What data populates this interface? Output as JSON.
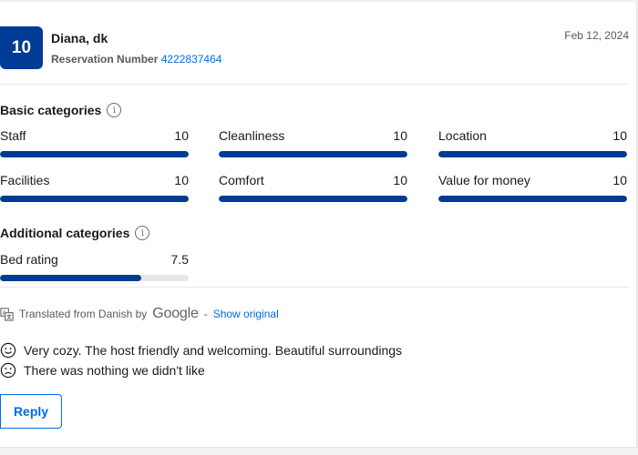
{
  "review": {
    "score": "10",
    "guest_name": "Diana, dk",
    "reservation_label": "Reservation Number",
    "reservation_number": "4222837464",
    "date": "Feb 12, 2024"
  },
  "basic": {
    "title": "Basic categories",
    "info_glyph": "i",
    "items": [
      {
        "label": "Staff",
        "value": "10",
        "fraction": 1.0
      },
      {
        "label": "Cleanliness",
        "value": "10",
        "fraction": 1.0
      },
      {
        "label": "Location",
        "value": "10",
        "fraction": 1.0
      },
      {
        "label": "Facilities",
        "value": "10",
        "fraction": 1.0
      },
      {
        "label": "Comfort",
        "value": "10",
        "fraction": 1.0
      },
      {
        "label": "Value for money",
        "value": "10",
        "fraction": 1.0
      }
    ]
  },
  "additional": {
    "title": "Additional categories",
    "info_glyph": "i",
    "items": [
      {
        "label": "Bed rating",
        "value": "7.5",
        "fraction": 0.75
      }
    ]
  },
  "translation": {
    "prefix": "Translated from Danish by",
    "provider": "Google",
    "separator": "-",
    "show_original": "Show original"
  },
  "comments": {
    "positive": "Very cozy. The host friendly and welcoming. Beautiful surroundings",
    "negative": "There was nothing we didn't like"
  },
  "actions": {
    "reply_label": "Reply"
  },
  "colors": {
    "brand_dark": "#003b95",
    "link": "#006ce4"
  }
}
